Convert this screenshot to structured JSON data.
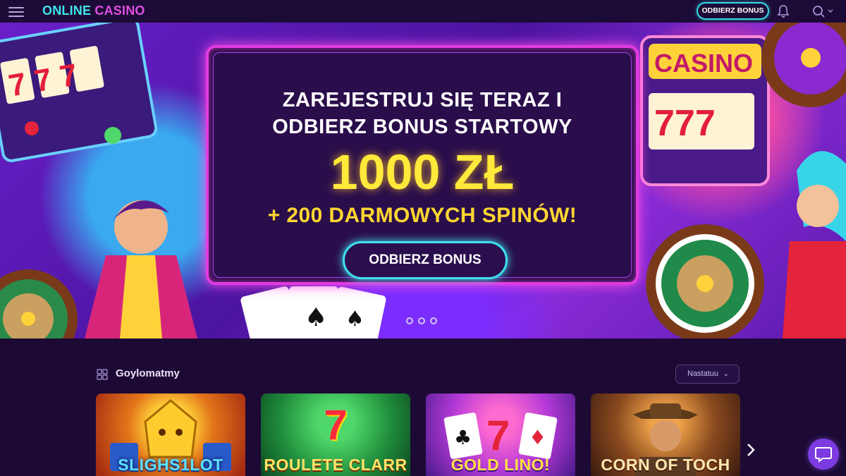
{
  "header": {
    "logo_word1": "ONLINE",
    "logo_word2": "CASINO",
    "bonus_button": "ODBIERZ BONUS",
    "icons": [
      "menu-icon",
      "bell-icon",
      "search-icon"
    ]
  },
  "hero": {
    "line1": "ZAREJESTRUJ SIĘ TERAZ I",
    "line2": "ODBIERZ BONUS STARTOWY",
    "amount": "1000 ZŁ",
    "spins": "+ 200 DARMOWYCH SPINÓW!",
    "cta": "ODBIERZ BONUS",
    "slide_count": 3
  },
  "games": {
    "title": "Goylomatmy",
    "sort_label": "Nastatuu",
    "cards": [
      {
        "label": "SLIGHS1LOT"
      },
      {
        "label": "ROULETE CLARR"
      },
      {
        "label": "GOLD LINO!"
      },
      {
        "label": "CORN OF TOCH"
      }
    ]
  },
  "colors": {
    "accent_cyan": "#36d9e6",
    "accent_magenta": "#e23be0",
    "gold": "#ffe93a",
    "bg": "#1c0b36"
  }
}
